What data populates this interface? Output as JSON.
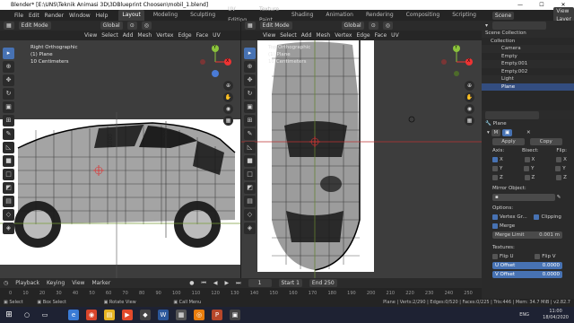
{
  "window": {
    "title": "Blender* [E:\\UNS\\Teknik Animasi 3D\\3DBlueprint Choosen\\mobil_1.blend]",
    "minimize": "—",
    "maximize": "☐",
    "close": "✕"
  },
  "topbar": {
    "menus": [
      "File",
      "Edit",
      "Render",
      "Window",
      "Help"
    ],
    "workspaces": [
      "Layout",
      "Modeling",
      "Sculpting",
      "UV Editing",
      "Texture Paint",
      "Shading",
      "Animation",
      "Rendering",
      "Compositing",
      "Scripting"
    ],
    "active_workspace": "Layout",
    "scene": "Scene",
    "view_layer": "View Layer"
  },
  "viewport_left": {
    "mode": "Edit Mode",
    "menus": [
      "View",
      "Select",
      "Add",
      "Mesh",
      "Vertex",
      "Edge",
      "Face",
      "UV"
    ],
    "orientation": "Global",
    "info": [
      "Right Orthographic",
      "(1) Plane",
      "10 Centimeters"
    ],
    "dimensions": [
      "1000",
      "724"
    ]
  },
  "viewport_right": {
    "mode": "Edit Mode",
    "menus": [
      "View",
      "Select",
      "Add",
      "Mesh",
      "Vertex",
      "Edge",
      "Face",
      "UV"
    ],
    "orientation": "Global",
    "info": [
      "Top Orthographic",
      "(1) Plane",
      "10 Centimeters"
    ]
  },
  "gizmo": {
    "x": "X",
    "y": "Y",
    "z": "Z"
  },
  "outliner": {
    "title": "Scene Collection",
    "items": [
      "Collection",
      "Camera",
      "Empty",
      "Empty.001",
      "Empty.002",
      "Light",
      "Plane"
    ]
  },
  "properties": {
    "object": "Plane",
    "modifier": "M",
    "apply": "Apply",
    "copy": "Copy",
    "axis_label": "Axis:",
    "bisect_label": "Bisect:",
    "flip_label": "Flip:",
    "axes": [
      "X",
      "Y",
      "Z"
    ],
    "mirror_object": "Mirror Object:",
    "options_label": "Options:",
    "vertex_groups": "Vertex Gr...",
    "clipping": "Clipping",
    "merge": "Merge",
    "merge_limit_label": "Merge Limit",
    "merge_limit_value": "0.001 m",
    "textures_label": "Textures:",
    "flip_u": "Flip U",
    "flip_v": "Flip V",
    "u_offset_label": "U Offset",
    "u_offset_value": "0.0000",
    "v_offset_label": "V Offset",
    "v_offset_value": "0.0000"
  },
  "timeline": {
    "playback": "Playback",
    "keying": "Keying",
    "view": "View",
    "marker": "Marker",
    "frame_current": "1",
    "start_label": "Start",
    "start": "1",
    "end_label": "End",
    "end": "250",
    "ticks": [
      "0",
      "10",
      "20",
      "30",
      "40",
      "50",
      "60",
      "70",
      "80",
      "90",
      "100",
      "110",
      "120",
      "130",
      "140",
      "150",
      "160",
      "170",
      "180",
      "190",
      "200",
      "210",
      "220",
      "230",
      "240",
      "250"
    ]
  },
  "statusbar": {
    "select": "Select",
    "box_select": "Box Select",
    "rotate_view": "Rotate View",
    "call_menu": "Call Menu",
    "stats": "Plane | Verts:2/290 | Edges:0/520 | Faces:0/225 | Tris:446 | Mem: 34.7 MiB | v2.82.7"
  },
  "taskbar": {
    "language": "ENG",
    "time": "11:00",
    "date": "18/04/2020"
  },
  "colors": {
    "accent": "#4772b3",
    "viewport_bg": "#3d3d3d",
    "panel_bg": "#2a2a2a",
    "header_bg": "#2b2b2b"
  }
}
